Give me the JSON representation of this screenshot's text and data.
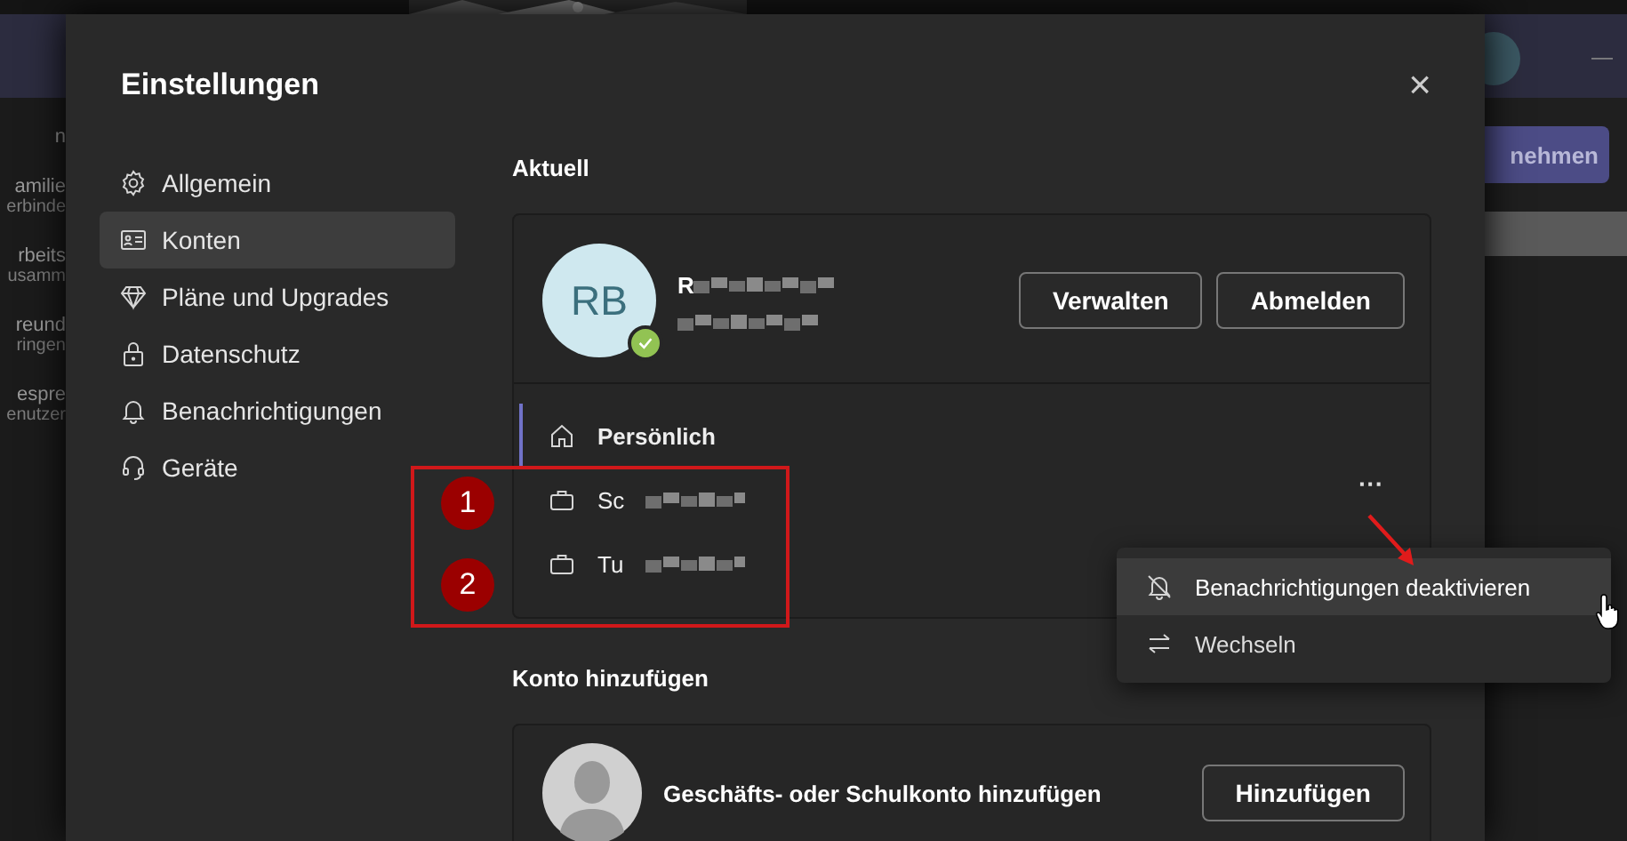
{
  "background_app": {
    "left_texts": [
      {
        "text": "n",
        "kind": "title"
      },
      {
        "text": "amilie",
        "kind": "title"
      },
      {
        "text": "erbinde",
        "kind": "sub"
      },
      {
        "text": "rbeits",
        "kind": "title"
      },
      {
        "text": "usamm",
        "kind": "sub"
      },
      {
        "text": "reund",
        "kind": "title"
      },
      {
        "text": "ringen",
        "kind": "sub"
      },
      {
        "text": "espre",
        "kind": "title"
      },
      {
        "text": "enutzer",
        "kind": "sub"
      }
    ],
    "right_button": "nehmen",
    "right_dash": "—"
  },
  "dialog": {
    "title": "Einstellungen",
    "close": "×",
    "nav": [
      {
        "label": "Allgemein",
        "kind": "gear",
        "selected": false
      },
      {
        "label": "Konten",
        "kind": "card",
        "selected": true
      },
      {
        "label": "Pläne und Upgrades",
        "kind": "diamond",
        "selected": false
      },
      {
        "label": "Datenschutz",
        "kind": "lock",
        "selected": false
      },
      {
        "label": "Benachrichtigungen",
        "kind": "bell",
        "selected": false
      },
      {
        "label": "Geräte",
        "kind": "headset",
        "selected": false
      }
    ],
    "current": {
      "heading": "Aktuell",
      "avatar_initials": "RB",
      "name": "R",
      "buttons": [
        "Verwalten",
        "Abmelden"
      ],
      "accounts": [
        {
          "label": "Persönlich",
          "kind": "home",
          "selected": true
        },
        {
          "label": "Sc",
          "kind": "briefcase",
          "selected": false
        },
        {
          "label": "Tu",
          "kind": "briefcase",
          "selected": false
        }
      ],
      "more": "···"
    },
    "add": {
      "heading": "Konto hinzufügen",
      "label": "Geschäfts- oder Schulkonto hinzufügen",
      "button": "Hinzufügen"
    }
  },
  "context_menu": [
    {
      "label": "Benachrichtigungen deaktivieren",
      "kind": "bell-off",
      "hovered": true
    },
    {
      "label": "Wechseln",
      "kind": "swap",
      "hovered": false
    }
  ],
  "annotations": {
    "badges": [
      "1",
      "2"
    ]
  }
}
